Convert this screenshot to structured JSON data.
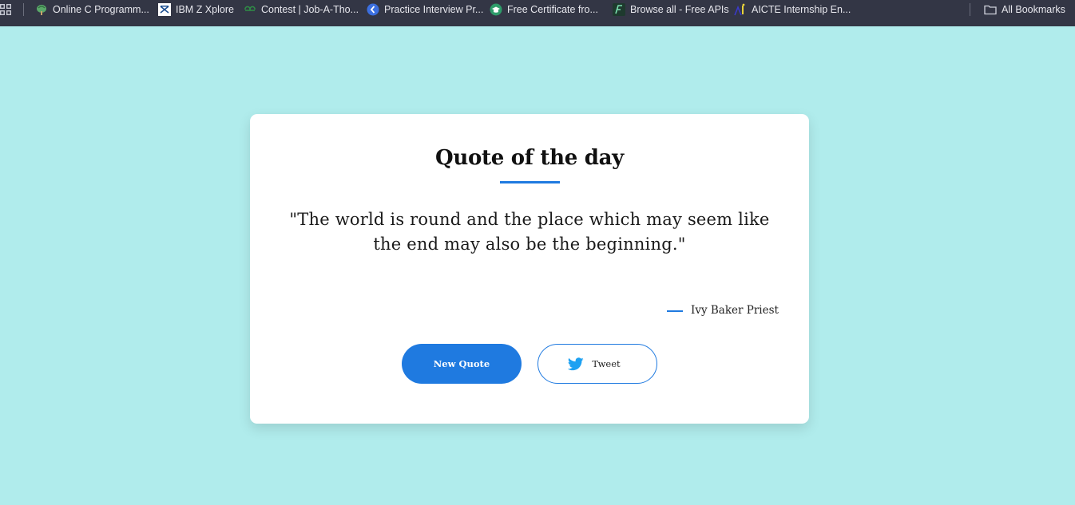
{
  "bookmarks_bar": {
    "items": [
      {
        "label": "Online C Programm...",
        "icon": "turtle-icon"
      },
      {
        "label": "IBM Z Xplore",
        "icon": "ibm-icon"
      },
      {
        "label": "Contest | Job-A-Tho...",
        "icon": "geeksforgeeks-icon"
      },
      {
        "label": "Practice Interview Pr...",
        "icon": "practice-icon"
      },
      {
        "label": "Free Certificate fro...",
        "icon": "graduation-cap-icon"
      },
      {
        "label": "Browse all - Free APIs",
        "icon": "free-apis-icon"
      },
      {
        "label": "AICTE Internship En...",
        "icon": "aicte-icon"
      }
    ],
    "all_bookmarks": {
      "label": "All Bookmarks",
      "icon": "folder-icon"
    }
  },
  "card": {
    "title": "Quote of the day",
    "quote": "\"The world is round and the place which may seem like the end may also be the beginning.\"",
    "author": "Ivy Baker Priest",
    "new_quote_label": "New Quote",
    "tweet_label": "Tweet"
  },
  "colors": {
    "page_background": "#b0ecec",
    "accent": "#1f7ae0",
    "bookmarks_bar": "#333645",
    "twitter": "#1da1f2"
  }
}
